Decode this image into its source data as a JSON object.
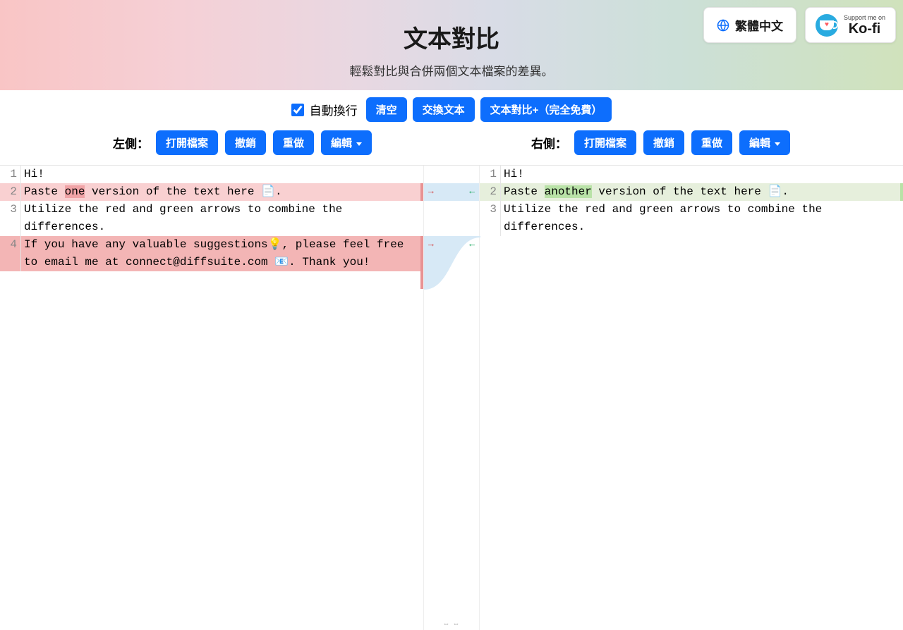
{
  "header": {
    "title": "文本對比",
    "subtitle": "輕鬆對比與合併兩個文本檔案的差異。"
  },
  "lang_button": "繁體中文",
  "kofi": {
    "small": "Support me on",
    "big": "Ko-fi"
  },
  "toolbar": {
    "wrap_label": "自動換行",
    "clear": "清空",
    "swap": "交換文本",
    "plus": "文本對比+（完全免費）",
    "left_label": "左側：",
    "right_label": "右側：",
    "open": "打開檔案",
    "undo": "撤銷",
    "redo": "重做",
    "edit": "編輯"
  },
  "left_lines": {
    "l1": "Hi!",
    "l2a": "Paste ",
    "l2b": "one",
    "l2c": " version of the text here 📄.",
    "l3": "Utilize the red and green arrows to combine the differences.",
    "l4": "If you have any valuable suggestions💡, please feel free to email me at connect@diffsuite.com 📧. Thank you!"
  },
  "right_lines": {
    "l1": "Hi!",
    "l2a": "Paste ",
    "l2b": "another",
    "l2c": " version of the text here 📄.",
    "l3": "Utilize the red and green arrows to combine the differences."
  },
  "line_numbers": {
    "n1": "1",
    "n2": "2",
    "n3": "3",
    "n4": "4"
  }
}
